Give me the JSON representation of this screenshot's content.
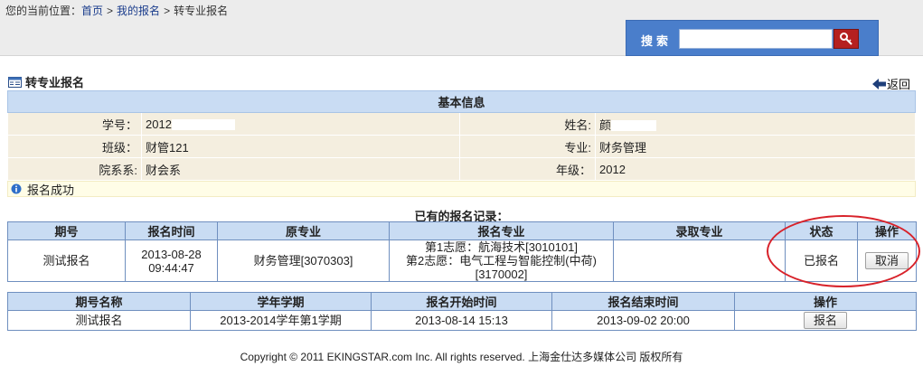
{
  "breadcrumb": {
    "prefix": "您的当前位置：",
    "home": "首页",
    "my_enroll": "我的报名",
    "current": "转专业报名",
    "separator": ">"
  },
  "search": {
    "label": "搜索",
    "value": "",
    "placeholder": ""
  },
  "page": {
    "title": "转专业报名",
    "back": "返回"
  },
  "basic_info": {
    "header": "基本信息",
    "student_id_label": "学号：",
    "student_id_value": "2012",
    "name_label": "姓名:",
    "name_value": "颜",
    "class_label": "班级：",
    "class_value": "财管121",
    "major_label": "专业:",
    "major_value": "财务管理",
    "dept_label": "院系系:",
    "dept_value": "财会系",
    "grade_label": "年级：",
    "grade_value": "2012"
  },
  "notice": {
    "text": "报名成功"
  },
  "records": {
    "title": "已有的报名记录：",
    "columns": [
      "期号",
      "报名时间",
      "原专业",
      "报名专业",
      "录取专业",
      "状态",
      "操作"
    ],
    "rows": [
      {
        "period": "测试报名",
        "time_date": "2013-08-28",
        "time_clock": "09:44:47",
        "original_major": "财务管理[3070303]",
        "choice1": "第1志愿：航海技术[3010101]",
        "choice2": "第2志愿：电气工程与智能控制(中荷)",
        "choice2_code": "[3170002]",
        "admitted_major": "",
        "status": "已报名",
        "action": "取消"
      }
    ]
  },
  "periods": {
    "columns": [
      "期号名称",
      "学年学期",
      "报名开始时间",
      "报名结束时间",
      "操作"
    ],
    "rows": [
      {
        "name": "测试报名",
        "term": "2013-2014学年第1学期",
        "start": "2013-08-14 15:13",
        "end": "2013-09-02 20:00",
        "action": "报名"
      }
    ]
  },
  "footer": {
    "text": "Copyright © 2011 EKINGSTAR.com Inc. All rights reserved. 上海金仕达多媒体公司 版权所有"
  },
  "colors": {
    "header_bg": "#c9dcf3",
    "label_bg": "#f4eedf",
    "search_bg": "#4a7ecb",
    "search_btn": "#b52020",
    "highlight_circle": "#d8222a"
  },
  "icons": {
    "title": "form-icon",
    "back": "back-arrow-icon",
    "search": "search-key-icon",
    "notice": "info-icon"
  }
}
